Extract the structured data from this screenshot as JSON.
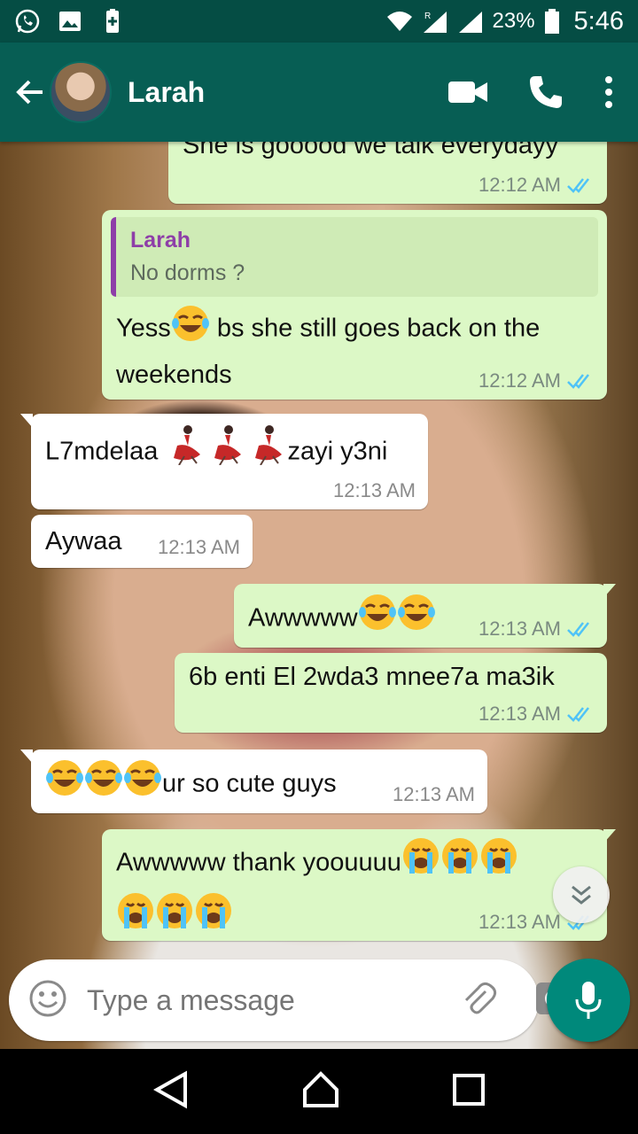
{
  "status_bar": {
    "battery": "23%",
    "time": "5:46",
    "roaming": "R"
  },
  "header": {
    "contact_name": "Larah"
  },
  "messages": [
    {
      "dir": "out",
      "text": "She is gooood we talk everydayy",
      "time": "12:12 AM"
    },
    {
      "dir": "out",
      "quote_name": "Larah",
      "quote_text": "No dorms ?",
      "text_a": "Yess",
      "text_b": " bs she still goes back on the",
      "text_c": "weekends",
      "time": "12:12 AM"
    },
    {
      "dir": "in",
      "text_a": "L7mdelaa ",
      "text_b": "zayi y3ni",
      "time": "12:13 AM"
    },
    {
      "dir": "in",
      "text": "Aywaa",
      "time": "12:13 AM"
    },
    {
      "dir": "out",
      "text": "Awwwww",
      "time": "12:13 AM"
    },
    {
      "dir": "out",
      "text": "6b enti El 2wda3 mnee7a ma3ik",
      "time": "12:13 AM"
    },
    {
      "dir": "in",
      "text": "ur so cute guys",
      "time": "12:13 AM"
    },
    {
      "dir": "out",
      "text": "Awwwww thank yoouuuu",
      "time": "12:13 AM"
    }
  ],
  "input": {
    "placeholder": "Type a message"
  },
  "colors": {
    "header": "#075e54",
    "status": "#054d44",
    "outgoing": "#dcf8c6",
    "incoming": "#ffffff",
    "accent": "#00897b"
  }
}
